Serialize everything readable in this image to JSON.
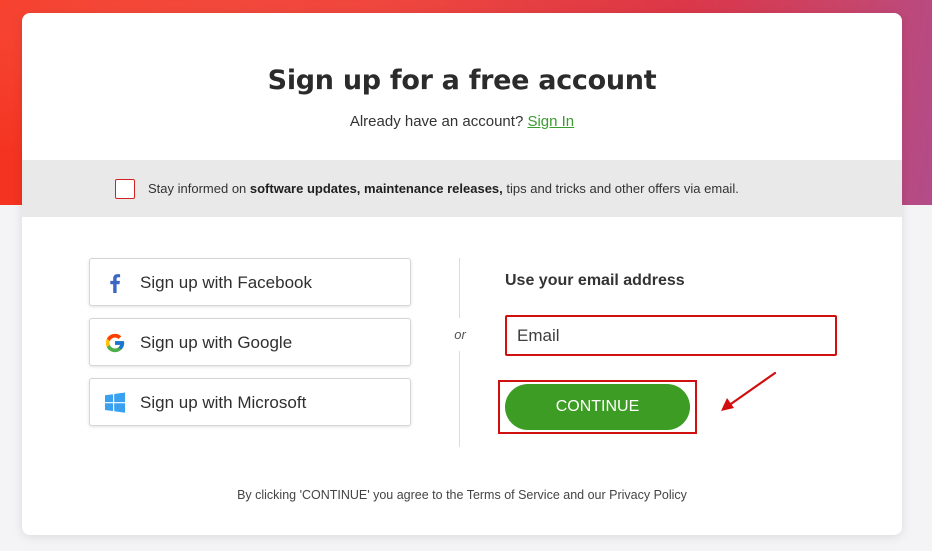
{
  "header": {
    "title": "Sign up for a free account",
    "already_text": "Already have an account? ",
    "signin_label": "Sign In"
  },
  "consent": {
    "checked": false,
    "text_prefix": "Stay informed on ",
    "text_bold": "software updates, maintenance releases,",
    "text_suffix": " tips and tricks and other offers via email."
  },
  "social": [
    {
      "label": "Sign up with Facebook",
      "icon": "facebook-icon"
    },
    {
      "label": "Sign up with Google",
      "icon": "google-icon"
    },
    {
      "label": "Sign up with Microsoft",
      "icon": "windows-icon"
    }
  ],
  "divider": {
    "or_label": "or"
  },
  "email_form": {
    "heading": "Use your email address",
    "email_placeholder": "Email",
    "email_value": "",
    "continue_label": "CONTINUE"
  },
  "footer": {
    "text": "By clicking 'CONTINUE' you agree to the Terms of Service and our Privacy Policy"
  },
  "colors": {
    "accent_green": "#3c9c24",
    "annotation_red": "#d10f0f",
    "hero_red": "#ee3b32"
  }
}
